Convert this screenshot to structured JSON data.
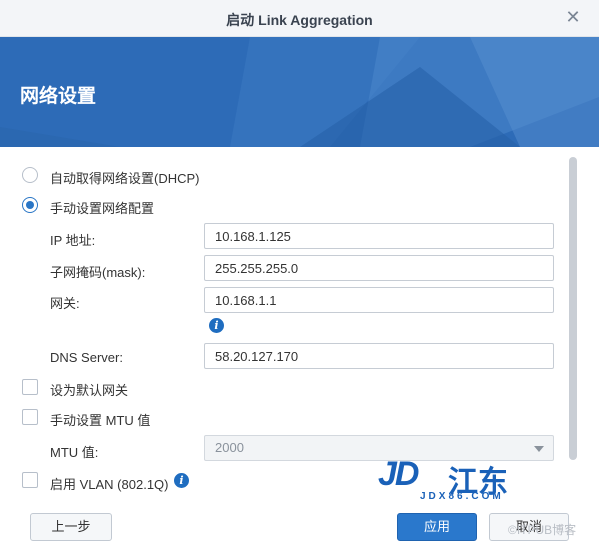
{
  "window": {
    "title": "启动 Link Aggregation"
  },
  "banner": {
    "heading": "网络设置"
  },
  "form": {
    "dhcp_label": "自动取得网络设置(DHCP)",
    "manual_label": "手动设置网络配置",
    "ip": {
      "label": "IP 地址:",
      "value": "10.168.1.125"
    },
    "mask": {
      "label": "子网掩码(mask):",
      "value": "255.255.255.0"
    },
    "gateway": {
      "label": "网关:",
      "value": "10.168.1.1"
    },
    "dns": {
      "label": "DNS Server:",
      "value": "58.20.127.170"
    },
    "default_gateway_label": "设为默认网关",
    "manual_mtu_label": "手动设置 MTU 值",
    "mtu": {
      "label": "MTU 值:",
      "value": "2000"
    },
    "vlan_label": "启用 VLAN (802.1Q)"
  },
  "buttons": {
    "back": "上一步",
    "apply": "应用",
    "cancel": "取消"
  },
  "watermark": {
    "logo": "JD",
    "cn": "江东",
    "sub": "JDX86.COM",
    "corner": "©ITPUB博客"
  },
  "icons": {
    "close": "close-icon",
    "info": "info-icon"
  },
  "colors": {
    "accent": "#2a78cc",
    "banner": "#2d6bb7"
  }
}
